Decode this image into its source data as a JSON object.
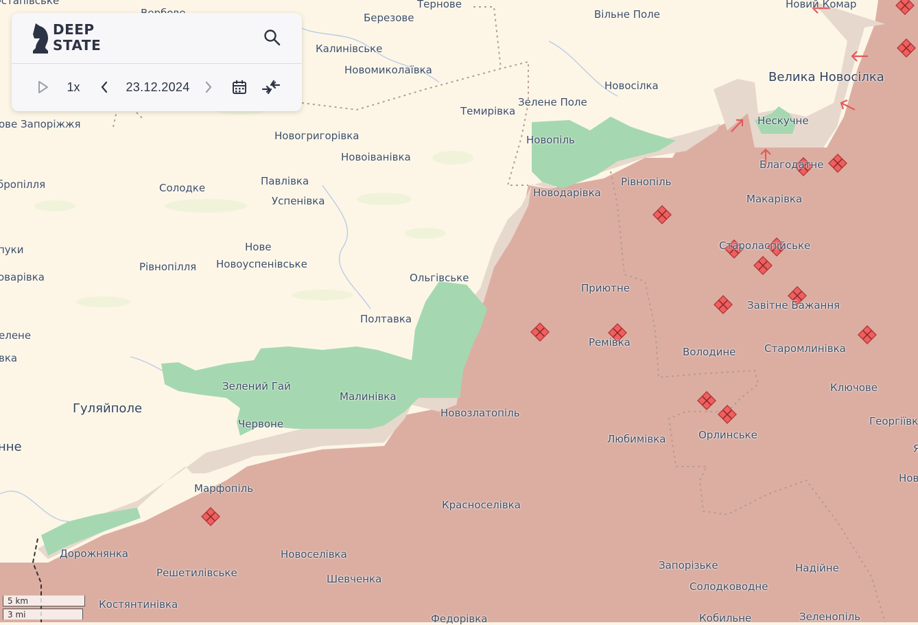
{
  "app": {
    "logo_line1": "DEEP",
    "logo_line2": "STATE"
  },
  "toolbar": {
    "speed_label": "1x",
    "date": "23.12.2024"
  },
  "scale": {
    "km_label": "5 km",
    "mi_label": "3 mi"
  },
  "colors": {
    "background": "#fdf6e6",
    "occupied": "#dcaea2",
    "contested": "#e7d8cd",
    "liberated": "#a5d8b1",
    "marker": "#ef5f5f"
  },
  "places": [
    {
      "name": "Остапівське",
      "cls": ""
    },
    {
      "name": "Вербове",
      "cls": ""
    },
    {
      "name": "Березове",
      "cls": ""
    },
    {
      "name": "Тернове",
      "cls": ""
    },
    {
      "name": "Вільне Поле",
      "cls": ""
    },
    {
      "name": "Новий Комар",
      "cls": ""
    },
    {
      "name": "Калинівське",
      "cls": ""
    },
    {
      "name": "Новомиколаївка",
      "cls": ""
    },
    {
      "name": "Велика Новосілка",
      "cls": "big"
    },
    {
      "name": "Новосілка",
      "cls": ""
    },
    {
      "name": "Зелене Поле",
      "cls": ""
    },
    {
      "name": "Темирівка",
      "cls": ""
    },
    {
      "name": "Нескучне",
      "cls": ""
    },
    {
      "name": "ове Запоріжжя",
      "cls": ""
    },
    {
      "name": "Новогригорівка",
      "cls": ""
    },
    {
      "name": "Новопіль",
      "cls": ""
    },
    {
      "name": "Новоіванівка",
      "cls": ""
    },
    {
      "name": "Благодатне",
      "cls": ""
    },
    {
      "name": "Рівнопіль",
      "cls": ""
    },
    {
      "name": "бропілля",
      "cls": ""
    },
    {
      "name": "Солодке",
      "cls": ""
    },
    {
      "name": "Павлівка",
      "cls": ""
    },
    {
      "name": "Новодарівка",
      "cls": ""
    },
    {
      "name": "Макарівка",
      "cls": ""
    },
    {
      "name": "Успенівка",
      "cls": ""
    },
    {
      "name": "Нове",
      "cls": ""
    },
    {
      "name": "Староласпійське",
      "cls": ""
    },
    {
      "name": "пуки",
      "cls": ""
    },
    {
      "name": "Новоуспенівське",
      "cls": ""
    },
    {
      "name": "Рівнопілля",
      "cls": ""
    },
    {
      "name": "оварівка",
      "cls": ""
    },
    {
      "name": "Ольгівське",
      "cls": ""
    },
    {
      "name": "Приютне",
      "cls": ""
    },
    {
      "name": "Завітне Бажання",
      "cls": ""
    },
    {
      "name": "Полтавка",
      "cls": ""
    },
    {
      "name": "елене",
      "cls": ""
    },
    {
      "name": "Ремівка",
      "cls": ""
    },
    {
      "name": "Володине",
      "cls": ""
    },
    {
      "name": "Старомлинівка",
      "cls": ""
    },
    {
      "name": "вка",
      "cls": ""
    },
    {
      "name": "Зелений Гай",
      "cls": ""
    },
    {
      "name": "Клю­чове",
      "cls": ""
    },
    {
      "name": "Малинівка",
      "cls": ""
    },
    {
      "name": "Гуляйполе",
      "cls": "big"
    },
    {
      "name": "Новозлатопіль",
      "cls": ""
    },
    {
      "name": "Червоне",
      "cls": ""
    },
    {
      "name": "Георгіївка",
      "cls": ""
    },
    {
      "name": "Любимівка",
      "cls": ""
    },
    {
      "name": "Орлинське",
      "cls": ""
    },
    {
      "name": "нне",
      "cls": "big"
    },
    {
      "name": "Я",
      "cls": ""
    },
    {
      "name": "Нов",
      "cls": ""
    },
    {
      "name": "Марфопіль",
      "cls": ""
    },
    {
      "name": "Красноселівка",
      "cls": ""
    },
    {
      "name": "Дорожнянка",
      "cls": ""
    },
    {
      "name": "Новоселівка",
      "cls": ""
    },
    {
      "name": "Запорізьке",
      "cls": ""
    },
    {
      "name": "Надійне",
      "cls": ""
    },
    {
      "name": "Решетилівське",
      "cls": ""
    },
    {
      "name": "Шевченка",
      "cls": ""
    },
    {
      "name": "Солодководне",
      "cls": ""
    },
    {
      "name": "Костянтинівка",
      "cls": ""
    },
    {
      "name": "Федорівка",
      "cls": ""
    },
    {
      "name": "Кобильне",
      "cls": ""
    },
    {
      "name": "Зеленопіль",
      "cls": ""
    }
  ]
}
